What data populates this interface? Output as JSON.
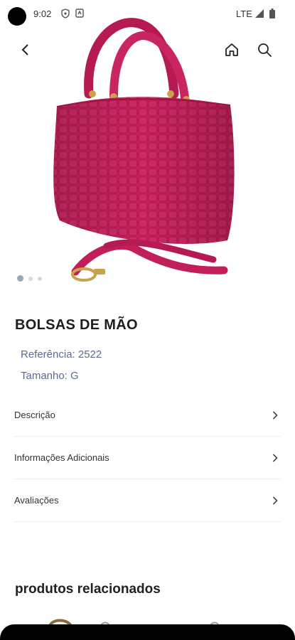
{
  "status_bar": {
    "time": "9:02",
    "network": "LTE",
    "icons": [
      "shield-icon",
      "notification-icon",
      "signal-icon",
      "battery-icon"
    ]
  },
  "nav": {
    "icons": [
      "back-arrow-icon",
      "home-icon",
      "search-icon"
    ]
  },
  "product": {
    "image_alt_icon": "handbag-image",
    "color": "#c21f5a",
    "title": "BOLSAS DE MÃO",
    "reference": "Referência: 2522",
    "size": "Tamanho: G",
    "image_count": 3,
    "active_image": 1
  },
  "sections": [
    {
      "label": "Descrição"
    },
    {
      "label": "Informações Adicionais"
    },
    {
      "label": "Avaliações"
    }
  ],
  "related": {
    "title": "produtos relacionados"
  },
  "colors": {
    "accent_text": "#5a6b95",
    "divider": "#eeeeee"
  }
}
